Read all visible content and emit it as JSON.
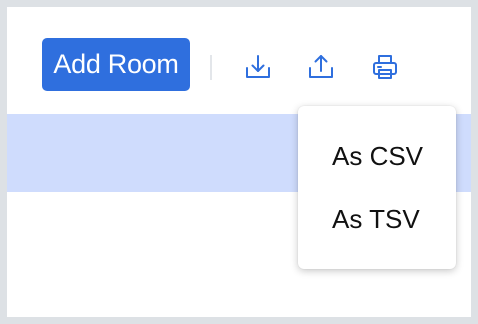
{
  "toolbar": {
    "add_room_label": "Add Room",
    "import_icon": "tray-arrow-down-icon",
    "export_icon": "tray-arrow-up-icon",
    "print_icon": "printer-icon",
    "accent_color": "#2f6fde",
    "icon_color": "#2f6fde"
  },
  "table": {
    "selected_row_color": "#cfdcfd"
  },
  "export_menu": {
    "items": [
      {
        "label": "As CSV"
      },
      {
        "label": "As TSV"
      }
    ]
  }
}
